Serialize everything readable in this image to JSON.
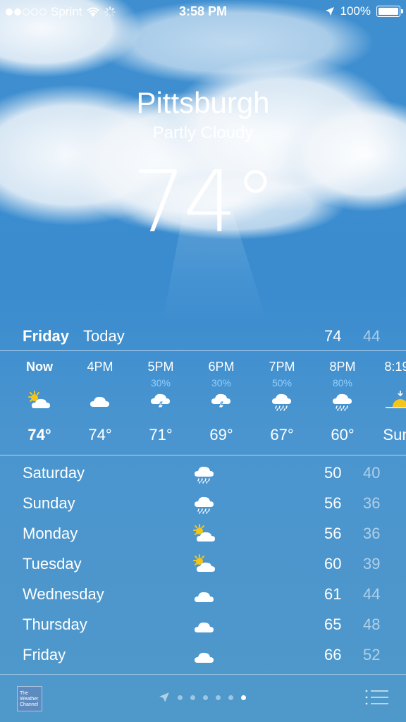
{
  "status_bar": {
    "carrier": "Sprint",
    "time": "3:58 PM",
    "battery": "100%"
  },
  "weather": {
    "city": "Pittsburgh",
    "condition": "Partly Cloudy",
    "temperature": "74°"
  },
  "today": {
    "day": "Friday",
    "label": "Today",
    "high": "74",
    "low": "44"
  },
  "hourly": [
    {
      "time": "Now",
      "precip": "",
      "icon": "partly-sunny-icon",
      "temp": "74°"
    },
    {
      "time": "4PM",
      "precip": "",
      "icon": "cloud-icon",
      "temp": "74°"
    },
    {
      "time": "5PM",
      "precip": "30%",
      "icon": "thunderstorm-icon",
      "temp": "71°"
    },
    {
      "time": "6PM",
      "precip": "30%",
      "icon": "thunderstorm-icon",
      "temp": "69°"
    },
    {
      "time": "7PM",
      "precip": "50%",
      "icon": "rain-icon",
      "temp": "67°"
    },
    {
      "time": "8PM",
      "precip": "80%",
      "icon": "rain-icon",
      "temp": "60°"
    },
    {
      "time": "8:19",
      "precip": "",
      "icon": "sunset-icon",
      "temp": "Sun"
    }
  ],
  "daily": [
    {
      "day": "Saturday",
      "icon": "rain-icon",
      "high": "50",
      "low": "40"
    },
    {
      "day": "Sunday",
      "icon": "rain-icon",
      "high": "56",
      "low": "36"
    },
    {
      "day": "Monday",
      "icon": "partly-sunny-icon",
      "high": "56",
      "low": "36"
    },
    {
      "day": "Tuesday",
      "icon": "partly-sunny-icon",
      "high": "60",
      "low": "39"
    },
    {
      "day": "Wednesday",
      "icon": "cloud-icon",
      "high": "61",
      "low": "44"
    },
    {
      "day": "Thursday",
      "icon": "cloud-icon",
      "high": "65",
      "low": "48"
    },
    {
      "day": "Friday",
      "icon": "cloud-icon",
      "high": "66",
      "low": "52"
    }
  ],
  "footer": {
    "logo_text": "The Weather Channel",
    "page_count": 6,
    "active_page": 6
  },
  "colors": {
    "sky": "#3f8fd0",
    "precip": "#8fd0ff",
    "sun": "#f5c518"
  }
}
